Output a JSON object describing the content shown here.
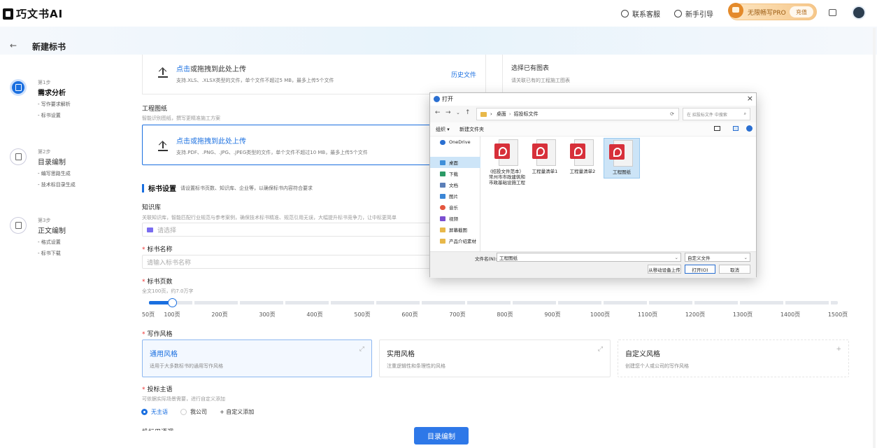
{
  "header": {
    "logo_text": "巧文书AI",
    "contact": "联系客服",
    "guide": "新手引导",
    "pro_label": "无限畅写PRO",
    "charge": "充值"
  },
  "page": {
    "back": "←",
    "title": "新建标书"
  },
  "steps": [
    {
      "num": "第1步",
      "name": "需求分析",
      "subs": [
        "写作要求解析",
        "标书设置"
      ]
    },
    {
      "num": "第2步",
      "name": "目录编制",
      "subs": [
        "编写思路生成",
        "技术标目录生成"
      ]
    },
    {
      "num": "第3步",
      "name": "正文编制",
      "subs": [
        "格式设置",
        "标书下载"
      ]
    }
  ],
  "upload_top": {
    "click": "点击",
    "rest": "或拖拽到此处上传",
    "desc": "支持.XLS、.XLSX类型的文件，单个文件不超过5 MB，最多上传5个文件",
    "history": "历史文件"
  },
  "existing": {
    "title": "选择已有图表",
    "desc": "请关联已有的工程施工图表"
  },
  "drawing": {
    "label": "工程图纸",
    "hint": "智能识别图纸，撰写更精准施工方案",
    "click": "点击或拖拽到此处上传",
    "desc": "支持.PDF、.PNG、.JPG、.JPEG类型的文件，单个文件不超过10 MB，最多上传5个文件"
  },
  "bid_settings": {
    "title": "标书设置",
    "hint": "请设置标书页数、知识库、企业等，以确保标书内容符合要求",
    "kb_label": "知识库",
    "kb_hint": "关联知识库，智能匹配行业规范与参考案例，确保技术标书精准、规范引用无误，大幅提升标书竞争力，让中标更简单",
    "kb_placeholder": "请选择",
    "name_label": "标书名称",
    "name_placeholder": "请输入标书名称",
    "pages_label": "标书页数",
    "pages_hint": "全文100页，约7.0万字",
    "pages_value": 100,
    "pages_ticks": [
      "50页",
      "100页",
      "200页",
      "300页",
      "400页",
      "500页",
      "600页",
      "700页",
      "800页",
      "900页",
      "1000页",
      "1100页",
      "1200页",
      "1300页",
      "1400页",
      "1500页"
    ],
    "style_label": "写作风格",
    "styles": [
      {
        "title": "通用风格",
        "desc": "适用于大多数标书的通用写作风格",
        "corner": "⤢"
      },
      {
        "title": "实用风格",
        "desc": "注重逻辑性和条理性的风格",
        "corner": "⤢"
      },
      {
        "title": "自定义风格",
        "desc": "创建您个人或公司的写作风格",
        "corner": "+"
      }
    ],
    "subject_label": "投标主语",
    "subject_hint": "可依据实际场景需要，进行自定义添加",
    "subjects": [
      "无主语",
      "我公司"
    ],
    "add_custom": "+ 自定义添加",
    "cut_label": "投标用语调"
  },
  "primary_button": "目录编制",
  "dialog": {
    "title": "打开",
    "close": "×",
    "path": [
      "桌面",
      "招投标文件"
    ],
    "search_placeholder": "在 招投标文件 中搜索",
    "organize": "组织 ▾",
    "new_folder": "新建文件夹",
    "tree": [
      "OneDrive",
      "桌面",
      "下载",
      "文档",
      "图片",
      "音乐",
      "视频",
      "屏幕截图",
      "产品介绍素材"
    ],
    "files": [
      "(招投文件范本）常州市市政建筑和市政基础设施工程",
      "工程量清单1",
      "工程量清单2",
      "工程图纸"
    ],
    "filename_label": "文件名(N):",
    "filename_value": "工程图纸",
    "filetype": "自定义文件",
    "mobile": "从移动设备上传",
    "open": "打开(O)",
    "cancel": "取消"
  },
  "colors": {
    "accent": "#1a6fe0",
    "pdf_red": "#d7303a"
  }
}
